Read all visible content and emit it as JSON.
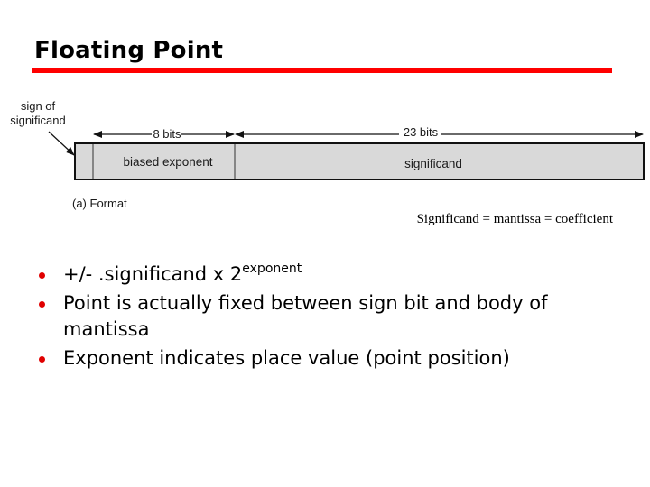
{
  "slide": {
    "title": "Floating Point",
    "accent_color": "#ff0000",
    "bullet_color": "#e00000"
  },
  "diagram": {
    "sign_label_line1": "sign of",
    "sign_label_line2": "significand",
    "exponent_width_label": "8 bits",
    "significand_width_label": "23 bits",
    "fields": [
      {
        "name": "sign",
        "label": "",
        "bits": 1
      },
      {
        "name": "biased-exponent",
        "label": "biased exponent",
        "bits": 8
      },
      {
        "name": "significand",
        "label": "significand",
        "bits": 23
      }
    ],
    "caption": "(a) Format",
    "box_fill": "#d9d9d9",
    "stroke_color": "#111111"
  },
  "note": "Significand = mantissa = coefficient",
  "bullets": [
    {
      "text": "+/- .significand x 2",
      "superscript": "exponent"
    },
    {
      "text": "Point is actually fixed between sign bit and body of mantissa"
    },
    {
      "text": "Exponent indicates place value (point position)"
    }
  ]
}
